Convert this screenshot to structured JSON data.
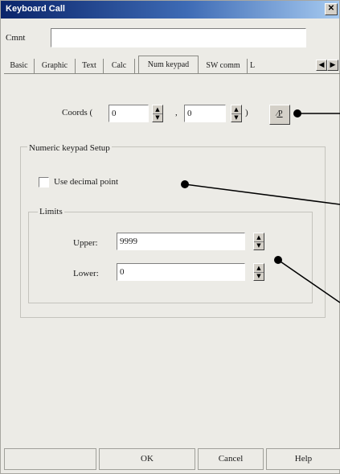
{
  "window": {
    "title": "Keyboard Call",
    "close_glyph": "✕"
  },
  "comment": {
    "label": "Cmnt",
    "value": ""
  },
  "tabs": [
    {
      "label": "Basic",
      "active": false
    },
    {
      "label": "Graphic",
      "active": false
    },
    {
      "label": "Text",
      "active": false
    },
    {
      "label": "Calc",
      "active": false
    },
    {
      "label": "Num keypad",
      "active": true
    },
    {
      "label": "SW comm",
      "active": false
    },
    {
      "label": "L",
      "active": false
    }
  ],
  "tab_scroll": {
    "left": "◀",
    "right": "▶"
  },
  "coords": {
    "label": "Coords (",
    "separator": ",",
    "close_paren": ")",
    "x": "0",
    "y": "0",
    "pick_button": "⁄P"
  },
  "numeric_group": {
    "title": "Numeric keypad Setup",
    "decimal_checkbox_label": "Use decimal point",
    "decimal_checked": false,
    "limits": {
      "title": "Limits",
      "upper_label": "Upper:",
      "upper_value": "9999",
      "lower_label": "Lower:",
      "lower_value": "0"
    }
  },
  "buttons": {
    "blank": "",
    "ok": "OK",
    "cancel": "Cancel",
    "help": "Help"
  },
  "colors": {
    "titlebar_start": "#0a246a",
    "titlebar_end": "#a6caf0",
    "dialog_bg": "#ecebe6"
  }
}
